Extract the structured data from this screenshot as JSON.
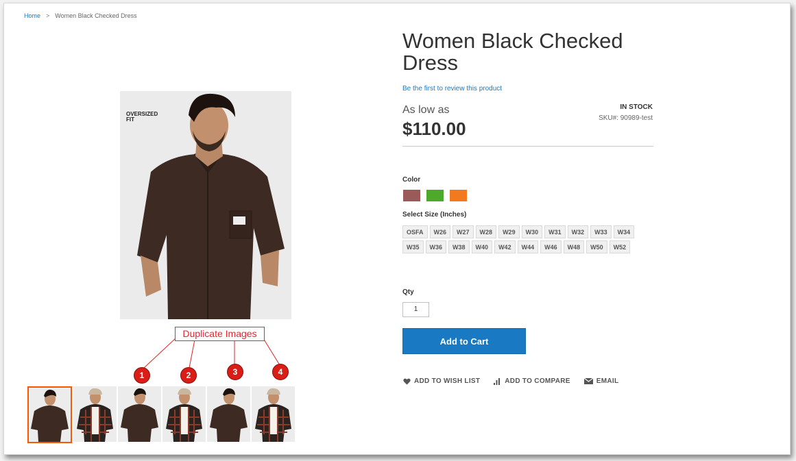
{
  "breadcrumb": {
    "home": "Home",
    "separator": ">",
    "current": "Women Black Checked Dress"
  },
  "product": {
    "title": "Women Black Checked Dress",
    "review_link": "Be the first to review this product",
    "price_prefix": "As low as",
    "price": "$110.00",
    "stock": "IN STOCK",
    "sku": "SKU#:  90989-test",
    "image_tag": "OVERSIZED\nFIT"
  },
  "options": {
    "color_label": "Color",
    "colors": [
      "#9b5a5a",
      "#4ea92a",
      "#f2791d"
    ],
    "size_label": "Select Size (Inches)",
    "sizes": [
      "OSFA",
      "W26",
      "W27",
      "W28",
      "W29",
      "W30",
      "W31",
      "W32",
      "W33",
      "W34",
      "W35",
      "W36",
      "W38",
      "W40",
      "W42",
      "W44",
      "W46",
      "W48",
      "W50",
      "W52"
    ],
    "qty_label": "Qty",
    "qty_value": "1"
  },
  "cart": {
    "add_to_cart": "Add to Cart"
  },
  "actions": {
    "wishlist": "ADD TO WISH LIST",
    "compare": "ADD TO COMPARE",
    "email": "EMAIL"
  },
  "annotation": {
    "label": "Duplicate Images",
    "badges": [
      "1",
      "2",
      "3",
      "4"
    ],
    "color": "#e22222"
  },
  "thumbnails": [
    {
      "variant": "brown-shirt",
      "active": true
    },
    {
      "variant": "checked-shirt",
      "active": false
    },
    {
      "variant": "brown-shirt",
      "active": false
    },
    {
      "variant": "checked-shirt",
      "active": false
    },
    {
      "variant": "brown-shirt",
      "active": false
    },
    {
      "variant": "checked-shirt",
      "active": false
    }
  ]
}
